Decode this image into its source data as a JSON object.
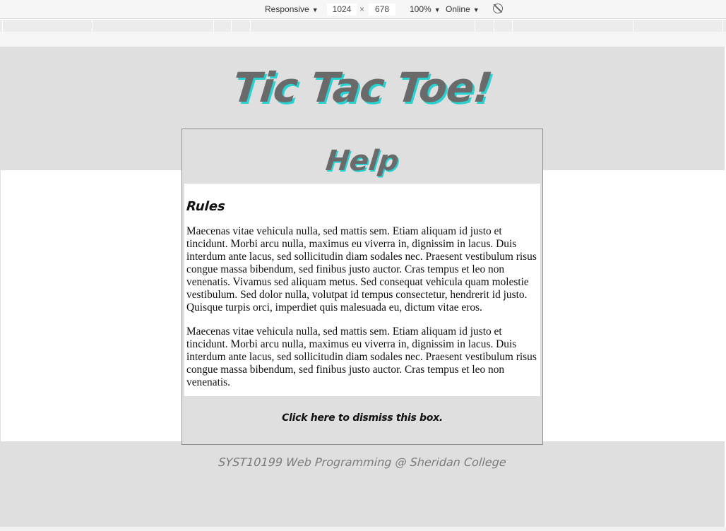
{
  "devtools": {
    "device": "Responsive",
    "width": "1024",
    "height": "678",
    "times": "×",
    "zoom": "100%",
    "throttle": "Online",
    "rotate_icon": "rotate-icon"
  },
  "page": {
    "title": "Tic Tac Toe!",
    "footer": "SYST10199 Web Programming @ Sheridan College"
  },
  "dialog": {
    "title": "Help",
    "rules_heading": "Rules",
    "paragraphs": [
      "Maecenas vitae vehicula nulla, sed mattis sem. Etiam aliquam id justo et tincidunt. Morbi arcu nulla, maximus eu viverra in, dignissim in lacus. Duis interdum ante lacus, sed sollicitudin diam sodales nec. Praesent vestibulum risus congue massa bibendum, sed finibus justo auctor. Cras tempus et leo non venenatis. Vivamus sed aliquam metus. Sed consequat vehicula quam molestie vestibulum. Sed dolor nulla, volutpat id tempus consectetur, hendrerit id justo. Quisque turpis orci, imperdiet quis malesuada eu, dictum vitae eros.",
      "Maecenas vitae vehicula nulla, sed mattis sem. Etiam aliquam id justo et tincidunt. Morbi arcu nulla, maximus eu viverra in, dignissim in lacus. Duis interdum ante lacus, sed sollicitudin diam sodales nec. Praesent vestibulum risus congue massa bibendum, sed finibus justo auctor. Cras tempus et leo non venenatis."
    ],
    "dismiss": "Click here to dismiss this box."
  },
  "colors": {
    "accent_shadow": "#2ad1d1",
    "title_gray": "#6a6a6a",
    "panel_gray": "#dfdfdf"
  }
}
